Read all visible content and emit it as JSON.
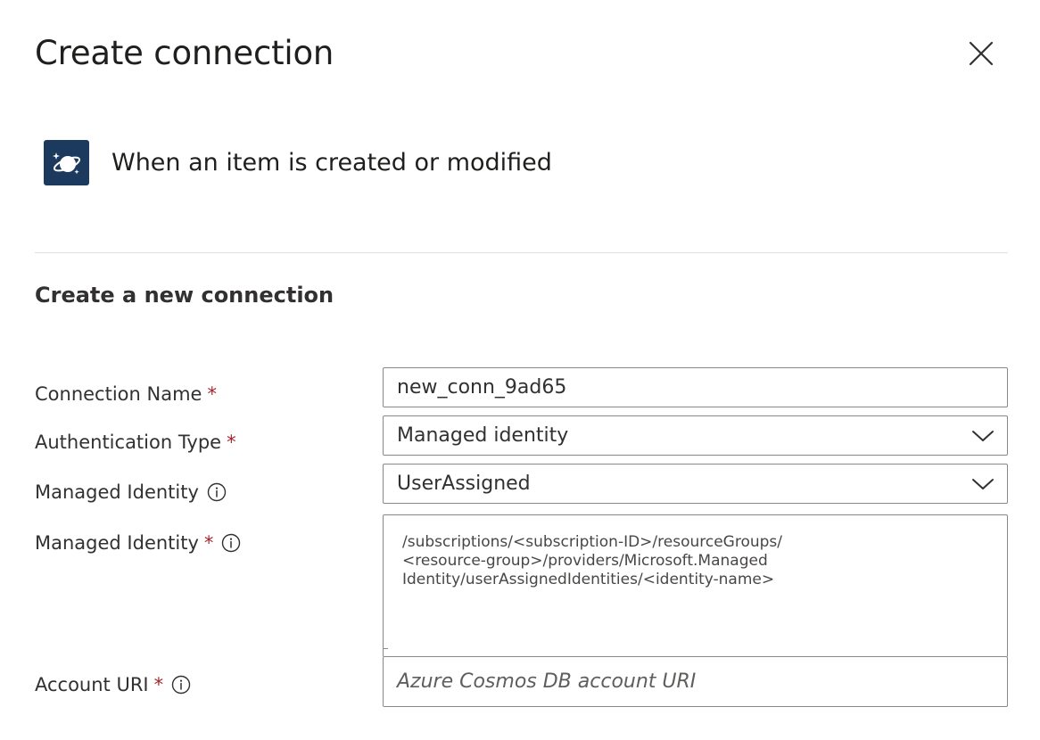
{
  "dialog": {
    "title": "Create connection",
    "close_icon": "close-icon"
  },
  "trigger": {
    "icon": "cosmos-db-planet-icon",
    "title": "When an item is created or modified"
  },
  "section": {
    "title": "Create a new connection"
  },
  "form": {
    "connection_name": {
      "label": "Connection Name",
      "required": "*",
      "value": "new_conn_9ad65"
    },
    "authentication_type": {
      "label": "Authentication Type",
      "required": "*",
      "value": "Managed identity"
    },
    "managed_identity_type": {
      "label": "Managed Identity",
      "value": "UserAssigned"
    },
    "managed_identity_id": {
      "label": "Managed Identity",
      "required": "*",
      "value": "/subscriptions/<subscription-ID>/resourceGroups/\n<resource-group>/providers/Microsoft.Managed\nIdentity/userAssignedIdentities/<identity-name>"
    },
    "account_uri": {
      "label": "Account URI",
      "required": "*",
      "placeholder": "Azure Cosmos DB account URI"
    }
  },
  "colors": {
    "required_asterisk": "#a4262c",
    "icon_background": "#1b3a5e",
    "border": "#8a8886",
    "divider": "#e1dfdd"
  }
}
